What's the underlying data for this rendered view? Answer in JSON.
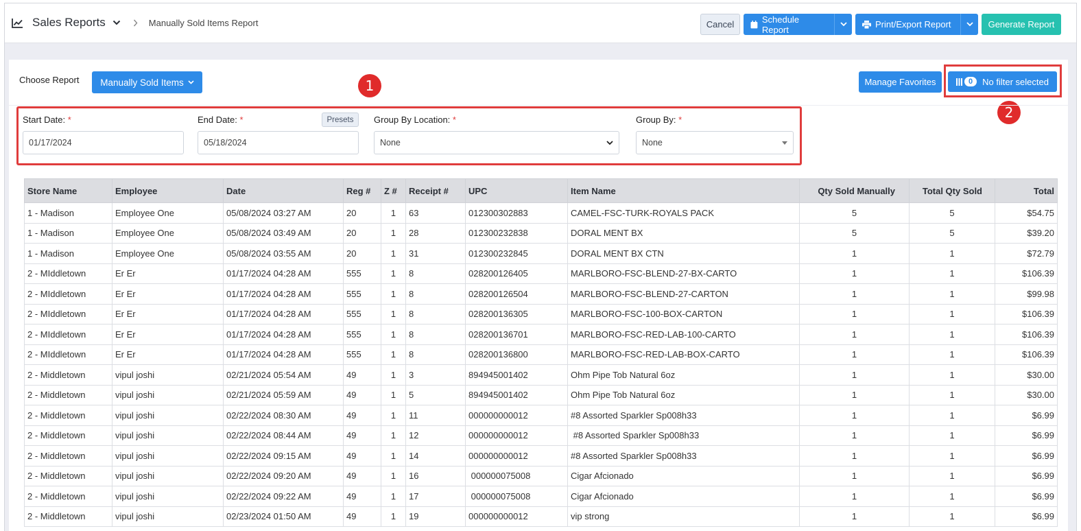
{
  "header": {
    "title": "Sales Reports",
    "breadcrumb": "Manually Sold Items Report",
    "cancel_label": "Cancel",
    "schedule_label": "Schedule Report",
    "print_label": "Print/Export Report",
    "generate_label": "Generate Report"
  },
  "toolbar": {
    "choose_label": "Choose Report",
    "report_selected": "Manually Sold Items",
    "favorites_label": "Manage Favorites",
    "filter_count": "0",
    "filter_label": "No filter selected",
    "marker_1": "1",
    "marker_2": "2"
  },
  "criteria": {
    "start_label": "Start Date:",
    "start_value": "01/17/2024",
    "end_label": "End Date:",
    "end_value": "05/18/2024",
    "presets_label": "Presets",
    "group_location_label": "Group By Location:",
    "group_location_value": "None",
    "group_by_label": "Group By:",
    "group_by_value": "None",
    "required_mark": "*"
  },
  "colors": {
    "primary": "#2e8be8",
    "teal": "#26c1b0",
    "annotation": "#e03c3c"
  },
  "table": {
    "columns": [
      "Store Name",
      "Employee",
      "Date",
      "Reg #",
      "Z #",
      "Receipt #",
      "UPC",
      "Item Name",
      "Qty Sold Manually",
      "Total Qty Sold",
      "Total"
    ],
    "rows": [
      [
        "1 - Madison",
        "Employee One",
        "05/08/2024 03:27 AM",
        "20",
        "1",
        "63",
        "012300302883",
        "CAMEL-FSC-TURK-ROYALS PACK",
        "5",
        "5",
        "$54.75"
      ],
      [
        "1 - Madison",
        "Employee One",
        "05/08/2024 03:49 AM",
        "20",
        "1",
        "28",
        "012300232838",
        "DORAL MENT BX",
        "5",
        "5",
        "$39.20"
      ],
      [
        "1 - Madison",
        "Employee One",
        "05/08/2024 03:55 AM",
        "20",
        "1",
        "31",
        "012300232845",
        "DORAL MENT BX CTN",
        "1",
        "1",
        "$72.79"
      ],
      [
        "2 - MIddletown",
        "Er Er",
        "01/17/2024 04:28 AM",
        "555",
        "1",
        "8",
        "028200126405",
        "MARLBORO-FSC-BLEND-27-BX-CARTO",
        "1",
        "1",
        "$106.39"
      ],
      [
        "2 - MIddletown",
        "Er Er",
        "01/17/2024 04:28 AM",
        "555",
        "1",
        "8",
        "028200126504",
        "MARLBORO-FSC-BLEND-27-CARTON",
        "1",
        "1",
        "$99.98"
      ],
      [
        "2 - MIddletown",
        "Er Er",
        "01/17/2024 04:28 AM",
        "555",
        "1",
        "8",
        "028200136305",
        "MARLBORO-FSC-100-BOX-CARTON",
        "1",
        "1",
        "$106.39"
      ],
      [
        "2 - MIddletown",
        "Er Er",
        "01/17/2024 04:28 AM",
        "555",
        "1",
        "8",
        "028200136701",
        "MARLBORO-FSC-RED-LAB-100-CARTO",
        "1",
        "1",
        "$106.39"
      ],
      [
        "2 - MIddletown",
        "Er Er",
        "01/17/2024 04:28 AM",
        "555",
        "1",
        "8",
        "028200136800",
        "MARLBORO-FSC-RED-LAB-BOX-CARTO",
        "1",
        "1",
        "$106.39"
      ],
      [
        "2 - Middletown",
        "vipul joshi",
        "02/21/2024 05:54 AM",
        "49",
        "1",
        "3",
        "894945001402",
        "Ohm Pipe Tob Natural 6oz",
        "1",
        "1",
        "$30.00"
      ],
      [
        "2 - Middletown",
        "vipul joshi",
        "02/21/2024 05:59 AM",
        "49",
        "1",
        "5",
        "894945001402",
        "Ohm Pipe Tob Natural 6oz",
        "1",
        "1",
        "$30.00"
      ],
      [
        "2 - Middletown",
        "vipul joshi",
        "02/22/2024 08:30 AM",
        "49",
        "1",
        "11",
        "000000000012",
        "#8 Assorted Sparkler Sp008h33",
        "1",
        "1",
        "$6.99"
      ],
      [
        "2 - Middletown",
        "vipul joshi",
        "02/22/2024 08:44 AM",
        "49",
        "1",
        "12",
        "000000000012",
        " #8 Assorted Sparkler Sp008h33",
        "1",
        "1",
        "$6.99"
      ],
      [
        "2 - Middletown",
        "vipul joshi",
        "02/22/2024 09:15 AM",
        "49",
        "1",
        "14",
        "000000000012",
        "#8 Assorted Sparkler Sp008h33",
        "1",
        "1",
        "$6.99"
      ],
      [
        "2 - Middletown",
        "vipul joshi",
        "02/22/2024 09:20 AM",
        "49",
        "1",
        "16",
        " 000000075008",
        "Cigar Afcionado",
        "1",
        "1",
        "$6.99"
      ],
      [
        "2 - Middletown",
        "vipul joshi",
        "02/22/2024 09:22 AM",
        "49",
        "1",
        "17",
        " 000000075008",
        "Cigar Afcionado",
        "1",
        "1",
        "$6.99"
      ],
      [
        "2 - Middletown",
        "vipul joshi",
        "02/23/2024 01:50 AM",
        "49",
        "1",
        "19",
        "000000000012",
        "vip strong",
        "1",
        "1",
        "$6.99"
      ]
    ]
  }
}
